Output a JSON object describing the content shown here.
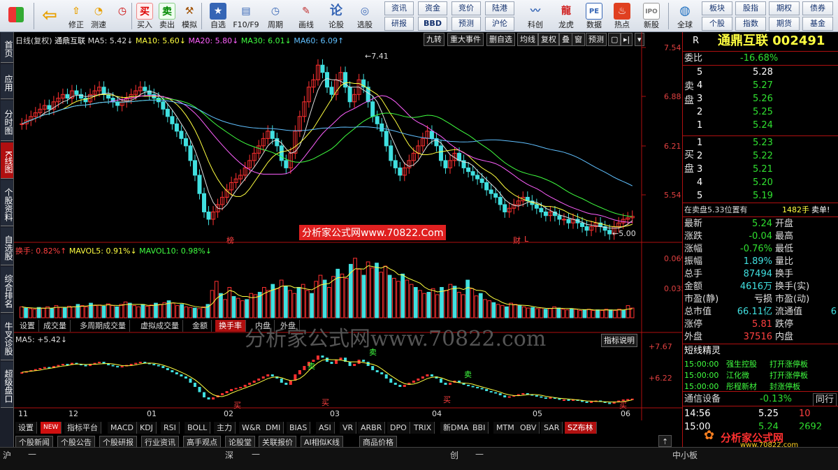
{
  "toolbar": {
    "buttons": [
      {
        "label": "",
        "icon": "grid-icon"
      },
      {
        "label": "",
        "icon": "back-arrow-icon"
      },
      {
        "label": "修正",
        "icon": "up-arrow-icon"
      },
      {
        "label": "测速",
        "icon": "clock-icon"
      },
      {
        "label": "买入",
        "icon": "buy-icon",
        "glyph": "买"
      },
      {
        "label": "卖出",
        "icon": "sell-icon",
        "glyph": "卖"
      },
      {
        "label": "模拟",
        "icon": "hammer-icon"
      },
      {
        "label": "自选",
        "icon": "star-icon"
      },
      {
        "label": "F10/F9",
        "icon": "f10-icon"
      },
      {
        "label": "周期",
        "icon": "period-icon"
      },
      {
        "label": "画线",
        "icon": "pen-icon"
      },
      {
        "label": "论股",
        "icon": "forum-icon"
      },
      {
        "label": "选股",
        "icon": "select-stock-icon"
      },
      {
        "label": "科创",
        "icon": "kechuang-icon"
      },
      {
        "label": "龙虎",
        "icon": "dragon-tiger-icon"
      },
      {
        "label": "数据",
        "icon": "pe-icon",
        "glyph": "PE"
      },
      {
        "label": "热点",
        "icon": "hot-icon"
      },
      {
        "label": "新股",
        "icon": "ipo-icon"
      },
      {
        "label": "全球",
        "icon": "globe-icon"
      }
    ],
    "text_buttons_row1": [
      "资讯",
      "资金",
      "竞价",
      "陆港"
    ],
    "text_buttons_row2": [
      "研报",
      "BBD",
      "预测",
      "沪伦"
    ],
    "right_row1": [
      "板块",
      "股指",
      "期权",
      "债券"
    ],
    "right_row2": [
      "个股",
      "指数",
      "期货",
      "基金"
    ]
  },
  "left_tabs": [
    "首页",
    "应用",
    "分时图",
    "K线图",
    "个股资料",
    "自选股",
    "综合排名",
    "牛叉诊股",
    "超级盘口"
  ],
  "chart": {
    "header": {
      "period": "日线(复权)",
      "name": "通鼎互联",
      "ma5": "MA5: 5.42↓",
      "ma10": "MA10: 5.60↓",
      "ma20": "MA20: 5.80↓",
      "ma30": "MA30: 6.01↓",
      "ma60": "MA60: 6.09↑"
    },
    "tools": [
      "九转",
      "重大事件",
      "删自选",
      "均线",
      "复权",
      "叠",
      "窗",
      "预测"
    ],
    "price_ticks": [
      "7.54",
      "6.88",
      "6.21",
      "5.54"
    ],
    "high_label": "7.41",
    "low_label": "5.00",
    "annot_bang": "榜",
    "annot_cai": "财",
    "annot_l": "L",
    "watermark1": "分析家公式网www.70822.Com",
    "vol_header": {
      "hs": "换手: 0.82%↑",
      "mavol5": "MAVOL5: 0.91%↓",
      "mavol10": "MAVOL10: 0.98%↓"
    },
    "vol_ticks": [
      "0.069",
      "0.035"
    ],
    "panel_tabs": [
      "设置",
      "成交量",
      "多周期成交量",
      "虚拟成交量",
      "金额",
      "换手率",
      "内盘",
      "外盘"
    ],
    "watermark2": "分析家公式网www.70822.com",
    "ind_header": "MA5: +5.42↓",
    "ind_help": "指标说明",
    "ind_ticks": [
      "+7.67",
      "+6.22"
    ],
    "sell_marks": [
      "卖",
      "卖",
      "卖"
    ],
    "buy_marks": [
      "买",
      "买",
      "买",
      "买"
    ],
    "months": [
      "11",
      "12",
      "01",
      "02",
      "03",
      "04",
      "05",
      "06"
    ],
    "bottom_tabs": [
      "设置",
      "NEW",
      "指标平台",
      "MACD",
      "KDJ",
      "RSI",
      "BOLL",
      "主力",
      "W&R",
      "DMI",
      "BIAS",
      "ASI",
      "VR",
      "ARBR",
      "DPO",
      "TRIX",
      "新DMA",
      "BBI",
      "MTM",
      "OBV",
      "SAR",
      "SZ布林"
    ],
    "news_tabs": [
      "个股新闻",
      "个股公告",
      "个股研报",
      "行业资讯",
      "高手观点",
      "论股堂",
      "关联报价",
      "AI相似K线",
      "商品价格"
    ],
    "volumes": [
      0.18,
      0.16,
      0.15,
      0.14,
      0.17,
      0.16,
      0.18,
      0.15,
      0.2,
      0.17,
      0.16,
      0.19,
      0.18,
      0.22,
      0.2,
      0.18,
      0.24,
      0.2,
      0.21,
      0.19,
      0.23,
      0.2,
      0.18,
      0.22,
      0.26,
      0.24,
      0.2,
      0.18,
      0.22,
      0.19,
      0.21,
      0.24,
      0.22,
      0.25,
      0.28,
      0.24,
      0.2,
      0.22,
      0.18,
      0.17,
      0.16,
      0.15,
      0.18,
      0.22,
      0.45,
      0.6,
      0.4,
      0.3,
      0.5,
      0.35,
      0.32,
      0.28,
      0.3,
      0.4,
      0.38,
      0.42,
      0.5,
      0.45,
      0.55,
      0.48,
      0.62,
      0.52,
      0.45,
      0.4,
      0.5,
      0.55,
      0.45,
      0.4,
      0.6,
      0.7,
      0.62,
      0.5,
      0.68,
      0.8,
      0.72,
      0.65,
      0.88,
      0.98,
      0.8,
      0.7,
      0.92,
      0.82,
      0.9,
      0.75,
      0.85,
      0.7,
      0.65,
      0.6,
      0.72,
      0.62,
      0.55,
      0.5,
      0.45,
      0.4,
      0.42,
      0.48,
      0.38,
      0.5,
      0.45,
      0.55,
      0.52,
      0.42,
      0.38,
      0.62,
      0.48,
      0.36,
      0.4,
      0.3,
      0.28,
      0.25,
      0.22,
      0.2,
      0.18,
      0.24,
      0.22,
      0.2,
      0.18,
      0.16,
      0.17,
      0.15,
      0.16,
      0.14,
      0.15,
      0.18,
      0.16,
      0.14,
      0.13,
      0.15,
      0.14,
      0.12,
      0.13,
      0.14,
      0.12,
      0.13,
      0.12,
      0.14,
      0.13,
      0.12,
      0.14,
      0.12,
      0.2,
      0.16
    ]
  },
  "right_panel": {
    "code": "R",
    "title": "通鼎互联 002491",
    "weibi_label": "委比",
    "weibi": "-16.68%",
    "sell_label": "卖盘",
    "buy_label": "买盘",
    "sells": [
      [
        "5",
        "5.28",
        ""
      ],
      [
        "4",
        "5.27",
        ""
      ],
      [
        "3",
        "5.26",
        ""
      ],
      [
        "2",
        "5.25",
        ""
      ],
      [
        "1",
        "5.24",
        ""
      ]
    ],
    "buys": [
      [
        "1",
        "5.23",
        ""
      ],
      [
        "2",
        "5.22",
        ""
      ],
      [
        "3",
        "5.21",
        ""
      ],
      [
        "4",
        "5.20",
        ""
      ],
      [
        "5",
        "5.19",
        ""
      ]
    ],
    "sell_tip": "在卖盘5.33位置有",
    "sell_tip_vol": "1482手",
    "sell_tip_end": "卖单!",
    "quote": [
      [
        "最新",
        "5.24",
        "开盘",
        ""
      ],
      [
        "涨跌",
        "-0.04",
        "最高",
        ""
      ],
      [
        "涨幅",
        "-0.76%",
        "最低",
        ""
      ],
      [
        "振幅",
        "1.89%",
        "量比",
        ""
      ],
      [
        "总手",
        "87494",
        "换手",
        ""
      ],
      [
        "金额",
        "4616万",
        "换手(实)",
        ""
      ],
      [
        "市盈(静)",
        "亏损",
        "市盈(动)",
        ""
      ],
      [
        "总市值",
        "66.11亿",
        "流通值",
        "6"
      ],
      [
        "涨停",
        "5.81",
        "跌停",
        ""
      ],
      [
        "外盘",
        "37516",
        "内盘",
        ""
      ]
    ],
    "short_label": "短线精灵",
    "short_items": [
      [
        "15:00:00",
        "强生控股",
        "打开涨停板"
      ],
      [
        "15:00:00",
        "江化微",
        "打开涨停板"
      ],
      [
        "15:00:00",
        "彤程新材",
        "封涨停板"
      ]
    ],
    "sector": "通信设备",
    "sector_chg": "-0.13%",
    "sector_btn": "同行",
    "ticks": [
      [
        "14:56",
        "5.25",
        "10"
      ],
      [
        "15:00",
        "5.24",
        "2692"
      ]
    ],
    "logo_text": "分析家公式网",
    "logo_url": "www.70822.com"
  },
  "statusbar": {
    "items": [
      "沪",
      "—",
      "深",
      "—",
      "创",
      "—",
      "中小板"
    ]
  }
}
